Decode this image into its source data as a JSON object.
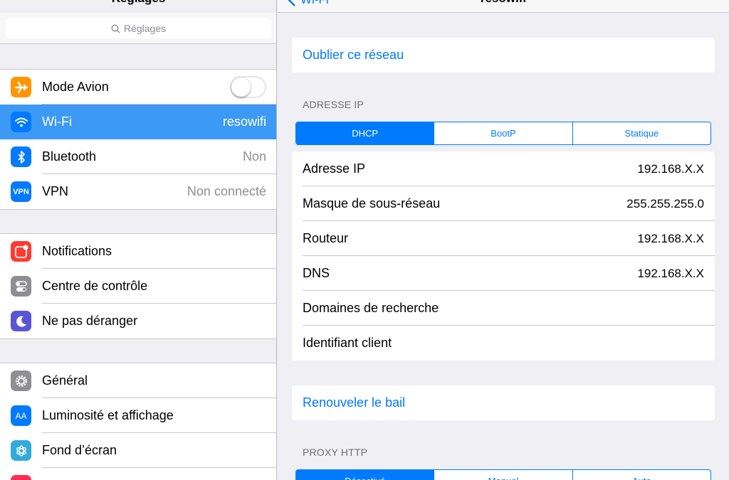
{
  "sidebar": {
    "title": "Réglages",
    "search_placeholder": "Réglages",
    "groups": [
      [
        {
          "label": "Mode Avion",
          "value": "",
          "icon": "airplane-icon",
          "icon_color": "#ff9500",
          "toggle": false
        },
        {
          "label": "Wi-Fi",
          "value": "resowifi",
          "icon": "wifi-icon",
          "icon_color": "#007aff",
          "selected": true
        },
        {
          "label": "Bluetooth",
          "value": "Non",
          "icon": "bluetooth-icon",
          "icon_color": "#007aff"
        },
        {
          "label": "VPN",
          "value": "Non connecté",
          "icon": "vpn-icon",
          "icon_color": "#007aff",
          "icon_text": "VPN"
        }
      ],
      [
        {
          "label": "Notifications",
          "value": "",
          "icon": "notifications-icon",
          "icon_color": "#ff3b30"
        },
        {
          "label": "Centre de contrôle",
          "value": "",
          "icon": "control-center-icon",
          "icon_color": "#8e8e93"
        },
        {
          "label": "Ne pas déranger",
          "value": "",
          "icon": "moon-icon",
          "icon_color": "#5856d6"
        }
      ],
      [
        {
          "label": "Général",
          "value": "",
          "icon": "gear-icon",
          "icon_color": "#8e8e93"
        },
        {
          "label": "Luminosité et affichage",
          "value": "",
          "icon": "brightness-icon",
          "icon_color": "#007aff",
          "icon_text": "AA"
        },
        {
          "label": "Fond d’écran",
          "value": "",
          "icon": "wallpaper-icon",
          "icon_color": "#34aadc"
        }
      ]
    ]
  },
  "main": {
    "back_label": "Wi-Fi",
    "title": "resowifi",
    "forget_label": "Oublier ce réseau",
    "ip_header": "ADRESSE IP",
    "ip_modes": [
      "DHCP",
      "BootP",
      "Statique"
    ],
    "ip_mode_selected": 0,
    "ip_rows": [
      {
        "label": "Adresse IP",
        "value": "192.168.X.X"
      },
      {
        "label": "Masque de sous-réseau",
        "value": "255.255.255.0"
      },
      {
        "label": "Routeur",
        "value": "192.168.X.X"
      },
      {
        "label": "DNS",
        "value": "192.168.X.X"
      },
      {
        "label": "Domaines de recherche",
        "value": ""
      },
      {
        "label": "Identifiant client",
        "value": ""
      }
    ],
    "renew_label": "Renouveler le bail",
    "proxy_header": "PROXY HTTP",
    "proxy_modes": [
      "Désactivé",
      "Manuel",
      "Auto"
    ],
    "proxy_mode_selected": 0
  },
  "colors": {
    "accent": "#007aff",
    "selected_row": "#3c9af5",
    "background": "#efeff4"
  }
}
